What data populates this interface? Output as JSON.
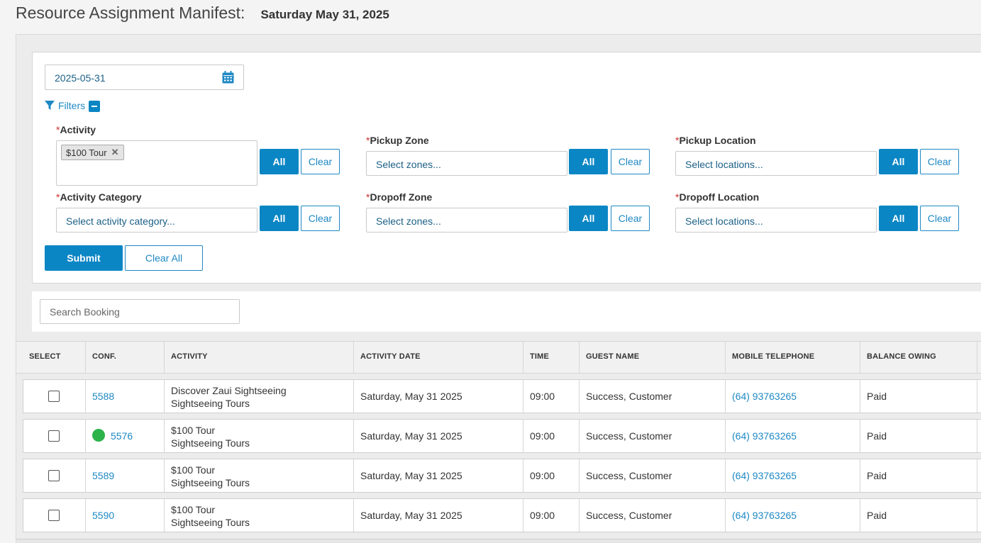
{
  "header": {
    "title": "Resource Assignment Manifest:",
    "date": "Saturday May 31, 2025"
  },
  "date_picker": {
    "value": "2025-05-31",
    "icon": "calendar-icon"
  },
  "filters": {
    "toggle_label": "Filters",
    "required_mark": "*",
    "all_label": "All",
    "clear_label": "Clear",
    "activity": {
      "label": "Activity",
      "chips": [
        "$100 Tour"
      ]
    },
    "activity_category": {
      "label": "Activity Category",
      "placeholder": "Select activity category..."
    },
    "pickup_zone": {
      "label": "Pickup Zone",
      "placeholder": "Select zones..."
    },
    "dropoff_zone": {
      "label": "Dropoff Zone",
      "placeholder": "Select zones..."
    },
    "pickup_location": {
      "label": "Pickup Location",
      "placeholder": "Select locations..."
    },
    "dropoff_location": {
      "label": "Dropoff Location",
      "placeholder": "Select locations..."
    },
    "submit_label": "Submit",
    "clear_all_label": "Clear All"
  },
  "search": {
    "placeholder": "Search Booking"
  },
  "table": {
    "columns": [
      "SELECT",
      "CONF.",
      "ACTIVITY",
      "ACTIVITY DATE",
      "TIME",
      "GUEST NAME",
      "MOBILE TELEPHONE",
      "BALANCE OWING"
    ],
    "rows": [
      {
        "conf": "5588",
        "status_dot": false,
        "activity": "Discover Zaui Sightseeing",
        "category": "Sightseeing Tours",
        "date": "Saturday, May 31 2025",
        "time": "09:00",
        "guest": "Success, Customer",
        "phone": "(64) 93763265",
        "balance": "Paid"
      },
      {
        "conf": "5576",
        "status_dot": true,
        "activity": "$100 Tour",
        "category": "Sightseeing Tours",
        "date": "Saturday, May 31 2025",
        "time": "09:00",
        "guest": "Success, Customer",
        "phone": "(64) 93763265",
        "balance": "Paid"
      },
      {
        "conf": "5589",
        "status_dot": false,
        "activity": "$100 Tour",
        "category": "Sightseeing Tours",
        "date": "Saturday, May 31 2025",
        "time": "09:00",
        "guest": "Success, Customer",
        "phone": "(64) 93763265",
        "balance": "Paid"
      },
      {
        "conf": "5590",
        "status_dot": false,
        "activity": "$100 Tour",
        "category": "Sightseeing Tours",
        "date": "Saturday, May 31 2025",
        "time": "09:00",
        "guest": "Success, Customer",
        "phone": "(64) 93763265",
        "balance": "Paid"
      }
    ]
  },
  "colors": {
    "accent": "#0b86c4",
    "link": "#1e88c4",
    "status_green": "#2cb34a",
    "required": "#c9302c"
  }
}
